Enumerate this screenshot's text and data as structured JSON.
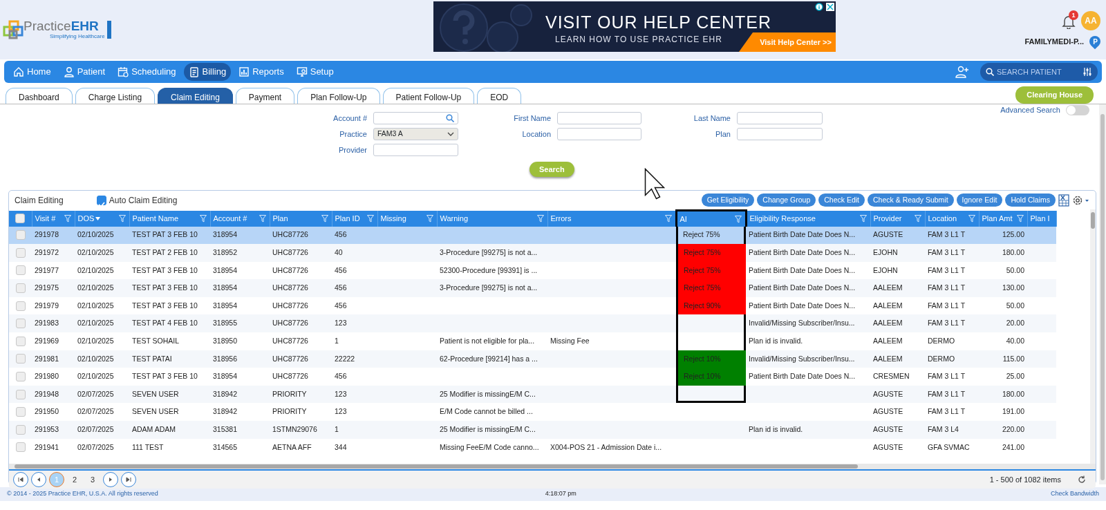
{
  "logo": {
    "name_a": "Practice",
    "name_b": "EHR",
    "tagline": "Simplifying Healthcare"
  },
  "ad": {
    "headline": "VISIT OUR HELP CENTER",
    "subline": "LEARN HOW TO USE PRACTICE EHR",
    "cta": "Visit Help Center >>"
  },
  "user": {
    "notifications": "1",
    "initials": "AA",
    "practice": "FAMILYMEDI-P...",
    "location_badge": "P"
  },
  "nav": [
    {
      "label": "Home",
      "selected": false
    },
    {
      "label": "Patient",
      "selected": false
    },
    {
      "label": "Scheduling",
      "selected": false
    },
    {
      "label": "Billing",
      "selected": true
    },
    {
      "label": "Reports",
      "selected": false
    },
    {
      "label": "Setup",
      "selected": false
    }
  ],
  "patient_search": {
    "placeholder": "SEARCH PATIENT"
  },
  "tabs": [
    {
      "label": "Dashboard",
      "selected": false
    },
    {
      "label": "Charge Listing",
      "selected": false
    },
    {
      "label": "Claim Editing",
      "selected": true
    },
    {
      "label": "Payment",
      "selected": false
    },
    {
      "label": "Plan Follow-Up",
      "selected": false
    },
    {
      "label": "Patient Follow-Up",
      "selected": false
    },
    {
      "label": "EOD",
      "selected": false
    }
  ],
  "clearing_house": "Clearing House",
  "search_form": {
    "advanced_search": {
      "label": "Advanced Search",
      "on": false
    },
    "fields": [
      {
        "label": "Account #",
        "kind": "search"
      },
      {
        "label": "First Name",
        "kind": "text"
      },
      {
        "label": "Last Name",
        "kind": "text"
      },
      {
        "label": "Practice",
        "kind": "select",
        "value": "FAM3 A"
      },
      {
        "label": "Location",
        "kind": "text"
      },
      {
        "label": "Plan",
        "kind": "text"
      },
      {
        "label": "Provider",
        "kind": "text"
      }
    ],
    "button": "Search"
  },
  "panel": {
    "title": "Claim Editing",
    "auto_claim_editing": {
      "label": "Auto Claim Editing",
      "checked": true
    },
    "actions": [
      "Get Eligibility",
      "Change Group",
      "Check Edit",
      "Check & Ready Submit",
      "Ignore Edit",
      "Hold Claims"
    ],
    "select_all": {
      "checked": false
    },
    "columns": [
      {
        "label": "Visit #",
        "filter": true,
        "sorted": false,
        "highlighted": false
      },
      {
        "label": "DOS",
        "filter": true,
        "sorted": true,
        "highlighted": false
      },
      {
        "label": "Patient Name",
        "filter": true,
        "sorted": false,
        "highlighted": false
      },
      {
        "label": "Account #",
        "filter": true,
        "sorted": false,
        "highlighted": false
      },
      {
        "label": "Plan",
        "filter": true,
        "sorted": false,
        "highlighted": false
      },
      {
        "label": "Plan ID",
        "filter": true,
        "sorted": false,
        "highlighted": false
      },
      {
        "label": "Missing",
        "filter": true,
        "sorted": false,
        "highlighted": false
      },
      {
        "label": "Warning",
        "filter": true,
        "sorted": false,
        "highlighted": false
      },
      {
        "label": "Errors",
        "filter": true,
        "sorted": false,
        "highlighted": false
      },
      {
        "label": "AI",
        "filter": true,
        "sorted": false,
        "highlighted": true
      },
      {
        "label": "Eligibility Response",
        "filter": true,
        "sorted": false,
        "highlighted": false
      },
      {
        "label": "Provider",
        "filter": true,
        "sorted": false,
        "highlighted": false
      },
      {
        "label": "Location",
        "filter": true,
        "sorted": false,
        "highlighted": false
      },
      {
        "label": "Plan Amt",
        "filter": true,
        "sorted": false,
        "highlighted": false
      },
      {
        "label": "Plan I",
        "filter": false,
        "sorted": false,
        "highlighted": false
      }
    ],
    "rows": [
      {
        "checked": false,
        "selected": true,
        "highlighted": true,
        "visit": "291978",
        "dos": "02/10/2025",
        "patient": "TEST PAT 3 FEB 10",
        "account": "318954",
        "plan": "UHC87726",
        "plan_id": "456",
        "ai": {
          "text": "Reject 75%"
        },
        "eligibility": "Patient Birth Date Date Does N...",
        "provider": "AGUSTE",
        "location": "FAM 3 L1 T",
        "plan_amt": "125.00"
      },
      {
        "checked": false,
        "selected": false,
        "highlighted": true,
        "visit": "291972",
        "dos": "02/10/2025",
        "patient": "TEST PAT 2 FEB 10",
        "account": "318952",
        "plan": "UHC87726",
        "plan_id": "40",
        "warning": "3-Procedure [99275] is not a...",
        "ai": {
          "text": "Reject 75%",
          "color": "#ff0000"
        },
        "eligibility": "Patient Birth Date Date Does N...",
        "provider": "EJOHN",
        "location": "FAM 3 L1 T",
        "plan_amt": "180.00"
      },
      {
        "checked": false,
        "selected": false,
        "highlighted": true,
        "visit": "291977",
        "dos": "02/10/2025",
        "patient": "TEST PAT 3 FEB 10",
        "account": "318954",
        "plan": "UHC87726",
        "plan_id": "456",
        "warning": "52300-Procedure [99391] is ...",
        "ai": {
          "text": "Reject 75%",
          "color": "#ff0000"
        },
        "eligibility": "Patient Birth Date Date Does N...",
        "provider": "EJOHN",
        "location": "FAM 3 L1 T",
        "plan_amt": "50.00"
      },
      {
        "checked": false,
        "selected": false,
        "highlighted": true,
        "visit": "291975",
        "dos": "02/10/2025",
        "patient": "TEST PAT 3 FEB 10",
        "account": "318954",
        "plan": "UHC87726",
        "plan_id": "456",
        "warning": "3-Procedure [99275] is not a...",
        "ai": {
          "text": "Reject 75%",
          "color": "#ff0000"
        },
        "eligibility": "Patient Birth Date Date Does N...",
        "provider": "AALEEM",
        "location": "FAM 3 L1 T",
        "plan_amt": "130.00"
      },
      {
        "checked": false,
        "selected": false,
        "highlighted": true,
        "visit": "291979",
        "dos": "02/10/2025",
        "patient": "TEST PAT 3 FEB 10",
        "account": "318954",
        "plan": "UHC87726",
        "plan_id": "456",
        "ai": {
          "text": "Reject 90%",
          "color": "#ff0000"
        },
        "eligibility": "Patient Birth Date Date Does N...",
        "provider": "AALEEM",
        "location": "FAM 3 L1 T",
        "plan_amt": "50.00"
      },
      {
        "checked": false,
        "selected": false,
        "highlighted": true,
        "visit": "291983",
        "dos": "02/10/2025",
        "patient": "TEST PAT 4 FEB 10",
        "account": "318955",
        "plan": "UHC87726",
        "plan_id": "123",
        "eligibility": "Invalid/Missing Subscriber/Insu...",
        "provider": "AALEEM",
        "location": "FAM 3 L1 T",
        "plan_amt": "20.00"
      },
      {
        "checked": false,
        "selected": false,
        "highlighted": true,
        "visit": "291969",
        "dos": "02/10/2025",
        "patient": "TEST SOHAIL",
        "account": "318950",
        "plan": "UHC87726",
        "plan_id": "1",
        "warning": "Patient is not eligible for pla...",
        "errors": "Missing Fee",
        "eligibility": "Plan id is invalid.",
        "provider": "AALEEM",
        "location": "DERMO",
        "plan_amt": "40.00"
      },
      {
        "checked": false,
        "selected": false,
        "highlighted": true,
        "visit": "291981",
        "dos": "02/10/2025",
        "patient": "TEST PATAI",
        "account": "318956",
        "plan": "UHC87726",
        "plan_id": "22222",
        "warning": "62-Procedure [99214] has a ...",
        "ai": {
          "text": "Reject 10%",
          "color": "#008000"
        },
        "eligibility": "Invalid/Missing Subscriber/Insu...",
        "provider": "AALEEM",
        "location": "DERMO",
        "plan_amt": "115.00"
      },
      {
        "checked": false,
        "selected": false,
        "highlighted": true,
        "visit": "291980",
        "dos": "02/10/2025",
        "patient": "TEST PAT 3 FEB 10",
        "account": "318954",
        "plan": "UHC87726",
        "plan_id": "456",
        "ai": {
          "text": "Reject 10%",
          "color": "#008000"
        },
        "eligibility": "Patient Birth Date Date Does N...",
        "provider": "CRESMEN",
        "location": "FAM 3 L1 T",
        "plan_amt": "25.00"
      },
      {
        "checked": false,
        "selected": false,
        "highlighted": true,
        "visit": "291948",
        "dos": "02/07/2025",
        "patient": "SEVEN USER",
        "account": "318942",
        "plan": "PRIORITY",
        "plan_id": "123",
        "warning": "25 Modifier is missingE/M C...",
        "provider": "AGUSTE",
        "location": "FAM 3 L1 T",
        "plan_amt": "180.00"
      },
      {
        "checked": false,
        "selected": false,
        "highlighted": false,
        "visit": "291950",
        "dos": "02/07/2025",
        "patient": "SEVEN USER",
        "account": "318942",
        "plan": "PRIORITY",
        "plan_id": "123",
        "warning": "E/M Code cannot be billed ...",
        "provider": "AGUSTE",
        "location": "FAM 3 L1 T",
        "plan_amt": "191.00"
      },
      {
        "checked": false,
        "selected": false,
        "highlighted": false,
        "visit": "291953",
        "dos": "02/07/2025",
        "patient": "ADAM ADAM",
        "account": "315381",
        "plan": "1STMN29076",
        "plan_id": "1",
        "warning": "25 Modifier is missingE/M C...",
        "eligibility": "Plan id is invalid.",
        "provider": "AGUSTE",
        "location": "FAM 3 L4",
        "plan_amt": "220.00"
      },
      {
        "checked": false,
        "selected": false,
        "highlighted": false,
        "visit": "291941",
        "dos": "02/07/2025",
        "patient": "111 TEST",
        "account": "314565",
        "plan": "AETNA AFF",
        "plan_id": "344",
        "warning": "Missing FeeE/M Code canno...",
        "errors": "X004-POS 21 - Admission Date i...",
        "provider": "AGUSTE",
        "location": "GFA SVMAC",
        "plan_amt": "241.00"
      }
    ],
    "pager": {
      "pages": [
        {
          "label": "1",
          "selected": true
        },
        {
          "label": "2",
          "selected": false
        },
        {
          "label": "3",
          "selected": false
        }
      ],
      "summary": "1 - 500 of 1082 items"
    }
  },
  "footer": {
    "copyright": "© 2014 - 2025 Practice EHR, U.S.A. All rights reserved",
    "time": "4:18:07 pm",
    "link": "Check Bandwidth"
  }
}
